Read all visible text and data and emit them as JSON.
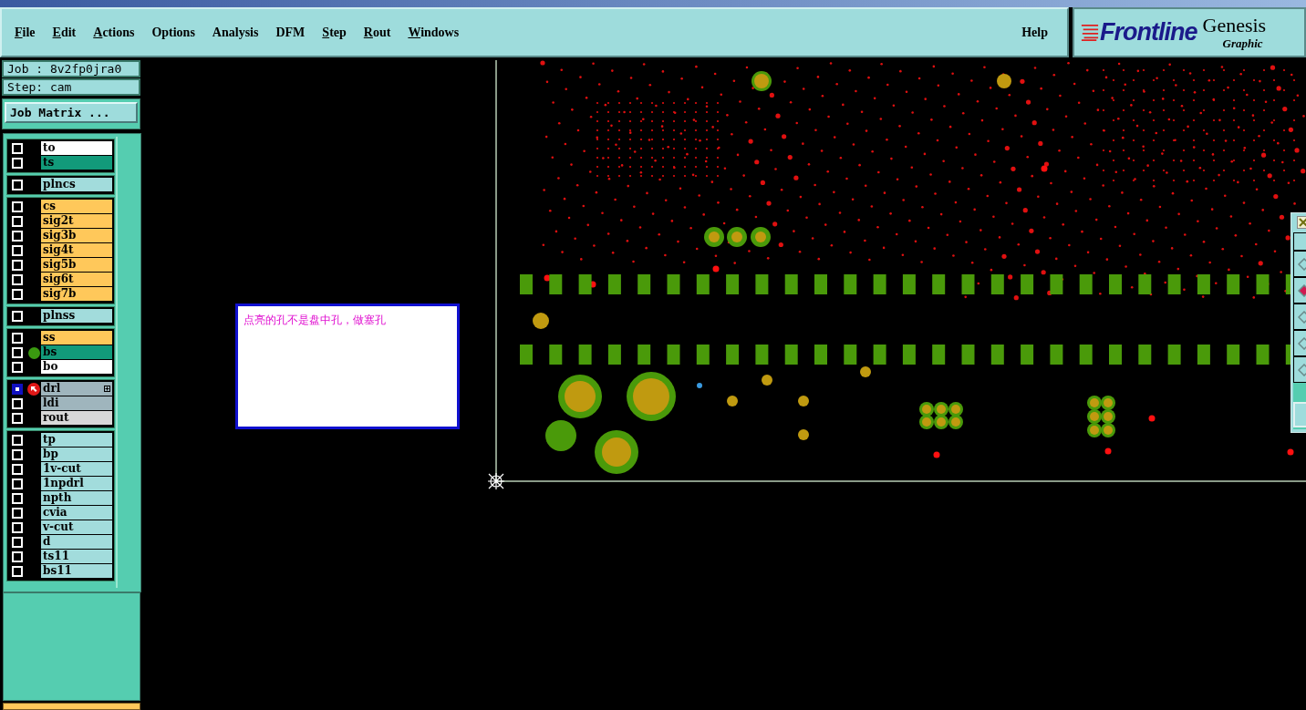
{
  "menu": [
    {
      "label": "File",
      "mnemonic": true
    },
    {
      "label": "Edit",
      "mnemonic": true
    },
    {
      "label": "Actions",
      "mnemonic": true
    },
    {
      "label": "Options",
      "mnemonic": false
    },
    {
      "label": "Analysis",
      "mnemonic": false
    },
    {
      "label": "DFM",
      "mnemonic": false
    },
    {
      "label": "Step",
      "mnemonic": true
    },
    {
      "label": "Rout",
      "mnemonic": true
    },
    {
      "label": "Windows",
      "mnemonic": true
    }
  ],
  "help": "Help",
  "brand": {
    "logo": "Frontline",
    "product": "Genesis",
    "subtitle": "Graphic"
  },
  "job": "Job : 8v2fp0jra0",
  "step": "Step: cam",
  "job_matrix_button": "Job Matrix ...",
  "layer_groups": [
    [
      {
        "name": "to",
        "color": "#ffffff",
        "displayed": false,
        "work": false
      },
      {
        "name": "ts",
        "color": "#129a7a",
        "displayed": false,
        "work": false
      }
    ],
    [
      {
        "name": "plncs",
        "color": "#a2dcdc",
        "displayed": false,
        "work": false
      }
    ],
    [
      {
        "name": "cs",
        "color": "#ffc85a",
        "displayed": false,
        "work": false
      },
      {
        "name": "sig2t",
        "color": "#ffc85a",
        "displayed": false,
        "work": false
      },
      {
        "name": "sig3b",
        "color": "#ffc85a",
        "displayed": false,
        "work": false
      },
      {
        "name": "sig4t",
        "color": "#ffc85a",
        "displayed": false,
        "work": false
      },
      {
        "name": "sig5b",
        "color": "#ffc85a",
        "displayed": false,
        "work": false
      },
      {
        "name": "sig6t",
        "color": "#ffc85a",
        "displayed": false,
        "work": false
      },
      {
        "name": "sig7b",
        "color": "#ffc85a",
        "displayed": false,
        "work": false
      }
    ],
    [
      {
        "name": "plnss",
        "color": "#a2dcdc",
        "displayed": false,
        "work": false
      }
    ],
    [
      {
        "name": "ss",
        "color": "#ffc85a",
        "displayed": false,
        "work": false
      },
      {
        "name": "bs",
        "color": "#129a7a",
        "displayed": true,
        "work": false
      },
      {
        "name": "bo",
        "color": "#ffffff",
        "displayed": false,
        "work": false
      }
    ],
    [
      {
        "name": "drl",
        "color": "#9fb5bd",
        "displayed": false,
        "work": true
      },
      {
        "name": "ldi",
        "color": "#9fb5bd",
        "displayed": false,
        "work": false
      },
      {
        "name": "rout",
        "color": "#d8d8d8",
        "displayed": false,
        "work": false
      }
    ],
    [
      {
        "name": "tp",
        "color": "#a2dcdc",
        "displayed": false,
        "work": false
      },
      {
        "name": "bp",
        "color": "#a2dcdc",
        "displayed": false,
        "work": false
      },
      {
        "name": "1v-cut",
        "color": "#a2dcdc",
        "displayed": false,
        "work": false
      },
      {
        "name": "1npdrl",
        "color": "#a2dcdc",
        "displayed": false,
        "work": false
      },
      {
        "name": "npth",
        "color": "#a2dcdc",
        "displayed": false,
        "work": false
      },
      {
        "name": "cvia",
        "color": "#a2dcdc",
        "displayed": false,
        "work": false
      },
      {
        "name": "v-cut",
        "color": "#a2dcdc",
        "displayed": false,
        "work": false
      },
      {
        "name": "d",
        "color": "#a2dcdc",
        "displayed": false,
        "work": false
      },
      {
        "name": "ts11",
        "color": "#a2dcdc",
        "displayed": false,
        "work": false
      },
      {
        "name": "bs11",
        "color": "#a2dcdc",
        "displayed": false,
        "work": false
      }
    ]
  ],
  "note": "点亮的孔不是盘中孔，做塞孔",
  "tool_palette": [
    {
      "selected": false
    },
    {
      "selected": true
    },
    {
      "selected": false
    },
    {
      "selected": false
    },
    {
      "selected": false
    }
  ]
}
